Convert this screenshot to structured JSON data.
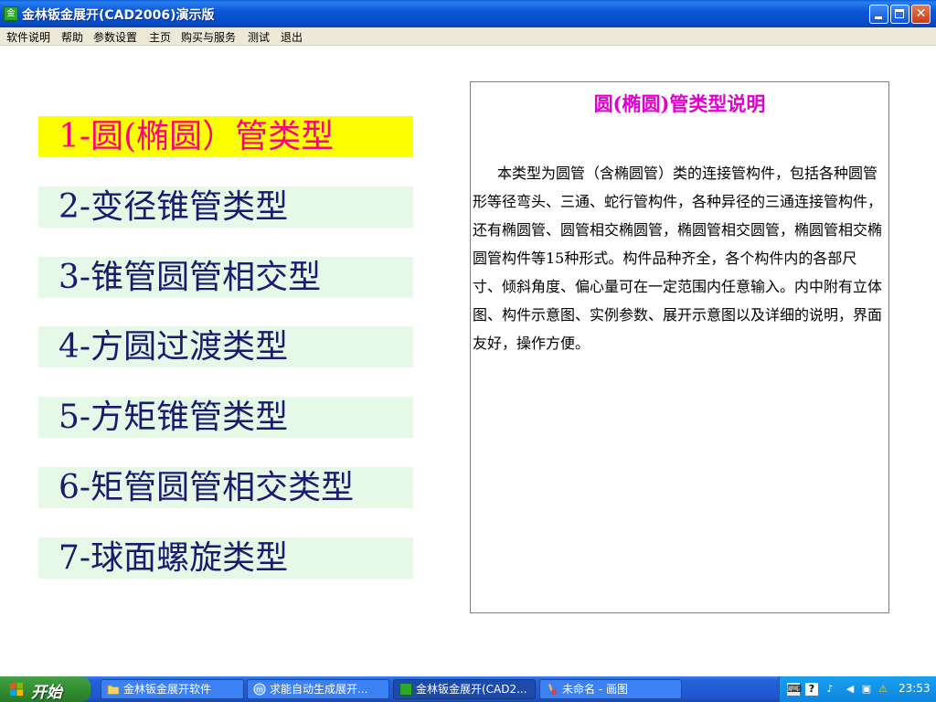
{
  "window": {
    "title": "金林钣金展开(CAD2006)演示版",
    "icon": "app-logo-icon"
  },
  "menu": [
    "软件说明",
    "帮助",
    "参数设置",
    "主页",
    "购买与服务",
    "测试",
    "退出"
  ],
  "types": [
    {
      "label": "1-圆(椭圆）管类型",
      "active": true
    },
    {
      "label": "2-变径锥管类型",
      "active": false
    },
    {
      "label": "3-锥管圆管相交型",
      "active": false
    },
    {
      "label": "4-方圆过渡类型",
      "active": false
    },
    {
      "label": "5-方矩锥管类型",
      "active": false
    },
    {
      "label": "6-矩管圆管相交类型",
      "active": false
    },
    {
      "label": "7-球面螺旋类型",
      "active": false
    }
  ],
  "description": {
    "title": "圆(椭圆)管类型说明",
    "body": "本类型为圆管（含椭圆管）类的连接管构件，包括各种圆管形等径弯头、三通、蛇行管构件，各种异径的三通连接管构件，还有椭圆管、圆管相交椭圆管，椭圆管相交圆管，椭圆管相交椭圆管构件等15种形式。构件品种齐全，各个构件内的各部尺寸、倾斜角度、偏心量可在一定范围内任意输入。内中附有立体图、构件示意图、实例参数、展开示意图以及详细的说明，界面友好，操作方便。"
  },
  "taskbar": {
    "start_label": "开始",
    "tasks": [
      {
        "label": "金林钣金展开软件",
        "icon": "folder-icon",
        "active": false
      },
      {
        "label": "求能自动生成展开...",
        "icon": "browser-icon",
        "active": false
      },
      {
        "label": "金林钣金展开(CAD2...",
        "icon": "app-logo-icon",
        "active": true
      },
      {
        "label": "未命名 - 画图",
        "icon": "paint-icon",
        "active": false
      }
    ],
    "clock": "23:53"
  },
  "colors": {
    "active_bg": "#fcff00",
    "active_text": "#ff0080",
    "item_bg": "#e6f8e6",
    "item_text": "#1a1a6e",
    "desc_title": "#e000d0"
  }
}
